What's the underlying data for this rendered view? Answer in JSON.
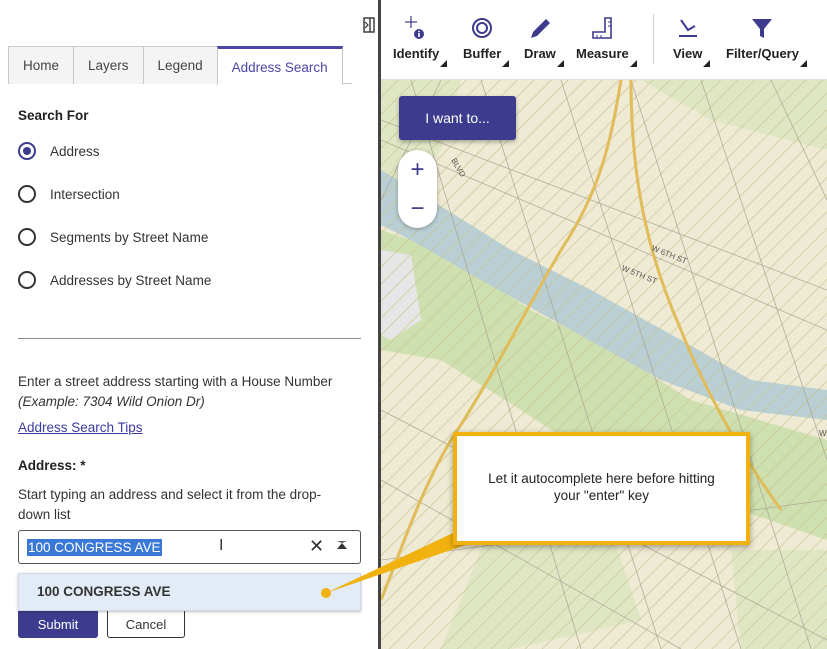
{
  "panel": {
    "tabs": [
      {
        "label": "Home"
      },
      {
        "label": "Layers"
      },
      {
        "label": "Legend"
      },
      {
        "label": "Address Search"
      }
    ],
    "search_for_label": "Search For",
    "options": [
      {
        "label": "Address"
      },
      {
        "label": "Intersection"
      },
      {
        "label": "Segments by Street Name"
      },
      {
        "label": "Addresses by Street Name"
      }
    ],
    "instructions": "Enter a street address starting with a House Number",
    "example": "(Example: 7304 Wild Onion Dr)",
    "tips_link": "Address Search Tips",
    "address_label": "Address: *",
    "address_hint_line1": "Start typing an address and select it from the drop-",
    "address_hint_line2": "down list",
    "address_value": "100 CONGRESS AVE",
    "clear_glyph": "✕",
    "dropdown_option": "100 CONGRESS AVE",
    "submit_label": "Submit",
    "cancel_label": "Cancel"
  },
  "toolbar": {
    "tools": [
      {
        "label": "Identify",
        "icon": "identify-icon"
      },
      {
        "label": "Buffer",
        "icon": "buffer-icon"
      },
      {
        "label": "Draw",
        "icon": "pencil-icon"
      },
      {
        "label": "Measure",
        "icon": "ruler-icon"
      },
      {
        "label": "View",
        "icon": "view-icon"
      },
      {
        "label": "Filter/Query",
        "icon": "funnel-icon"
      }
    ]
  },
  "map": {
    "i_want_to": "I want to...",
    "zoom_in": "+",
    "zoom_out": "−",
    "labels": {
      "blvd": "BLVD",
      "w6th_1": "W 6TH ST",
      "w6th_2": "W 5TH ST",
      "edge": "W"
    }
  },
  "callout": {
    "line1": "Let it autocomplete here before hitting",
    "line2": "your \"enter\" key"
  },
  "colors": {
    "accent": "#3d3b8e",
    "callout_border": "#f1b10f",
    "selection": "#3a78d8",
    "dropdown_bg": "#e3ecf6"
  }
}
